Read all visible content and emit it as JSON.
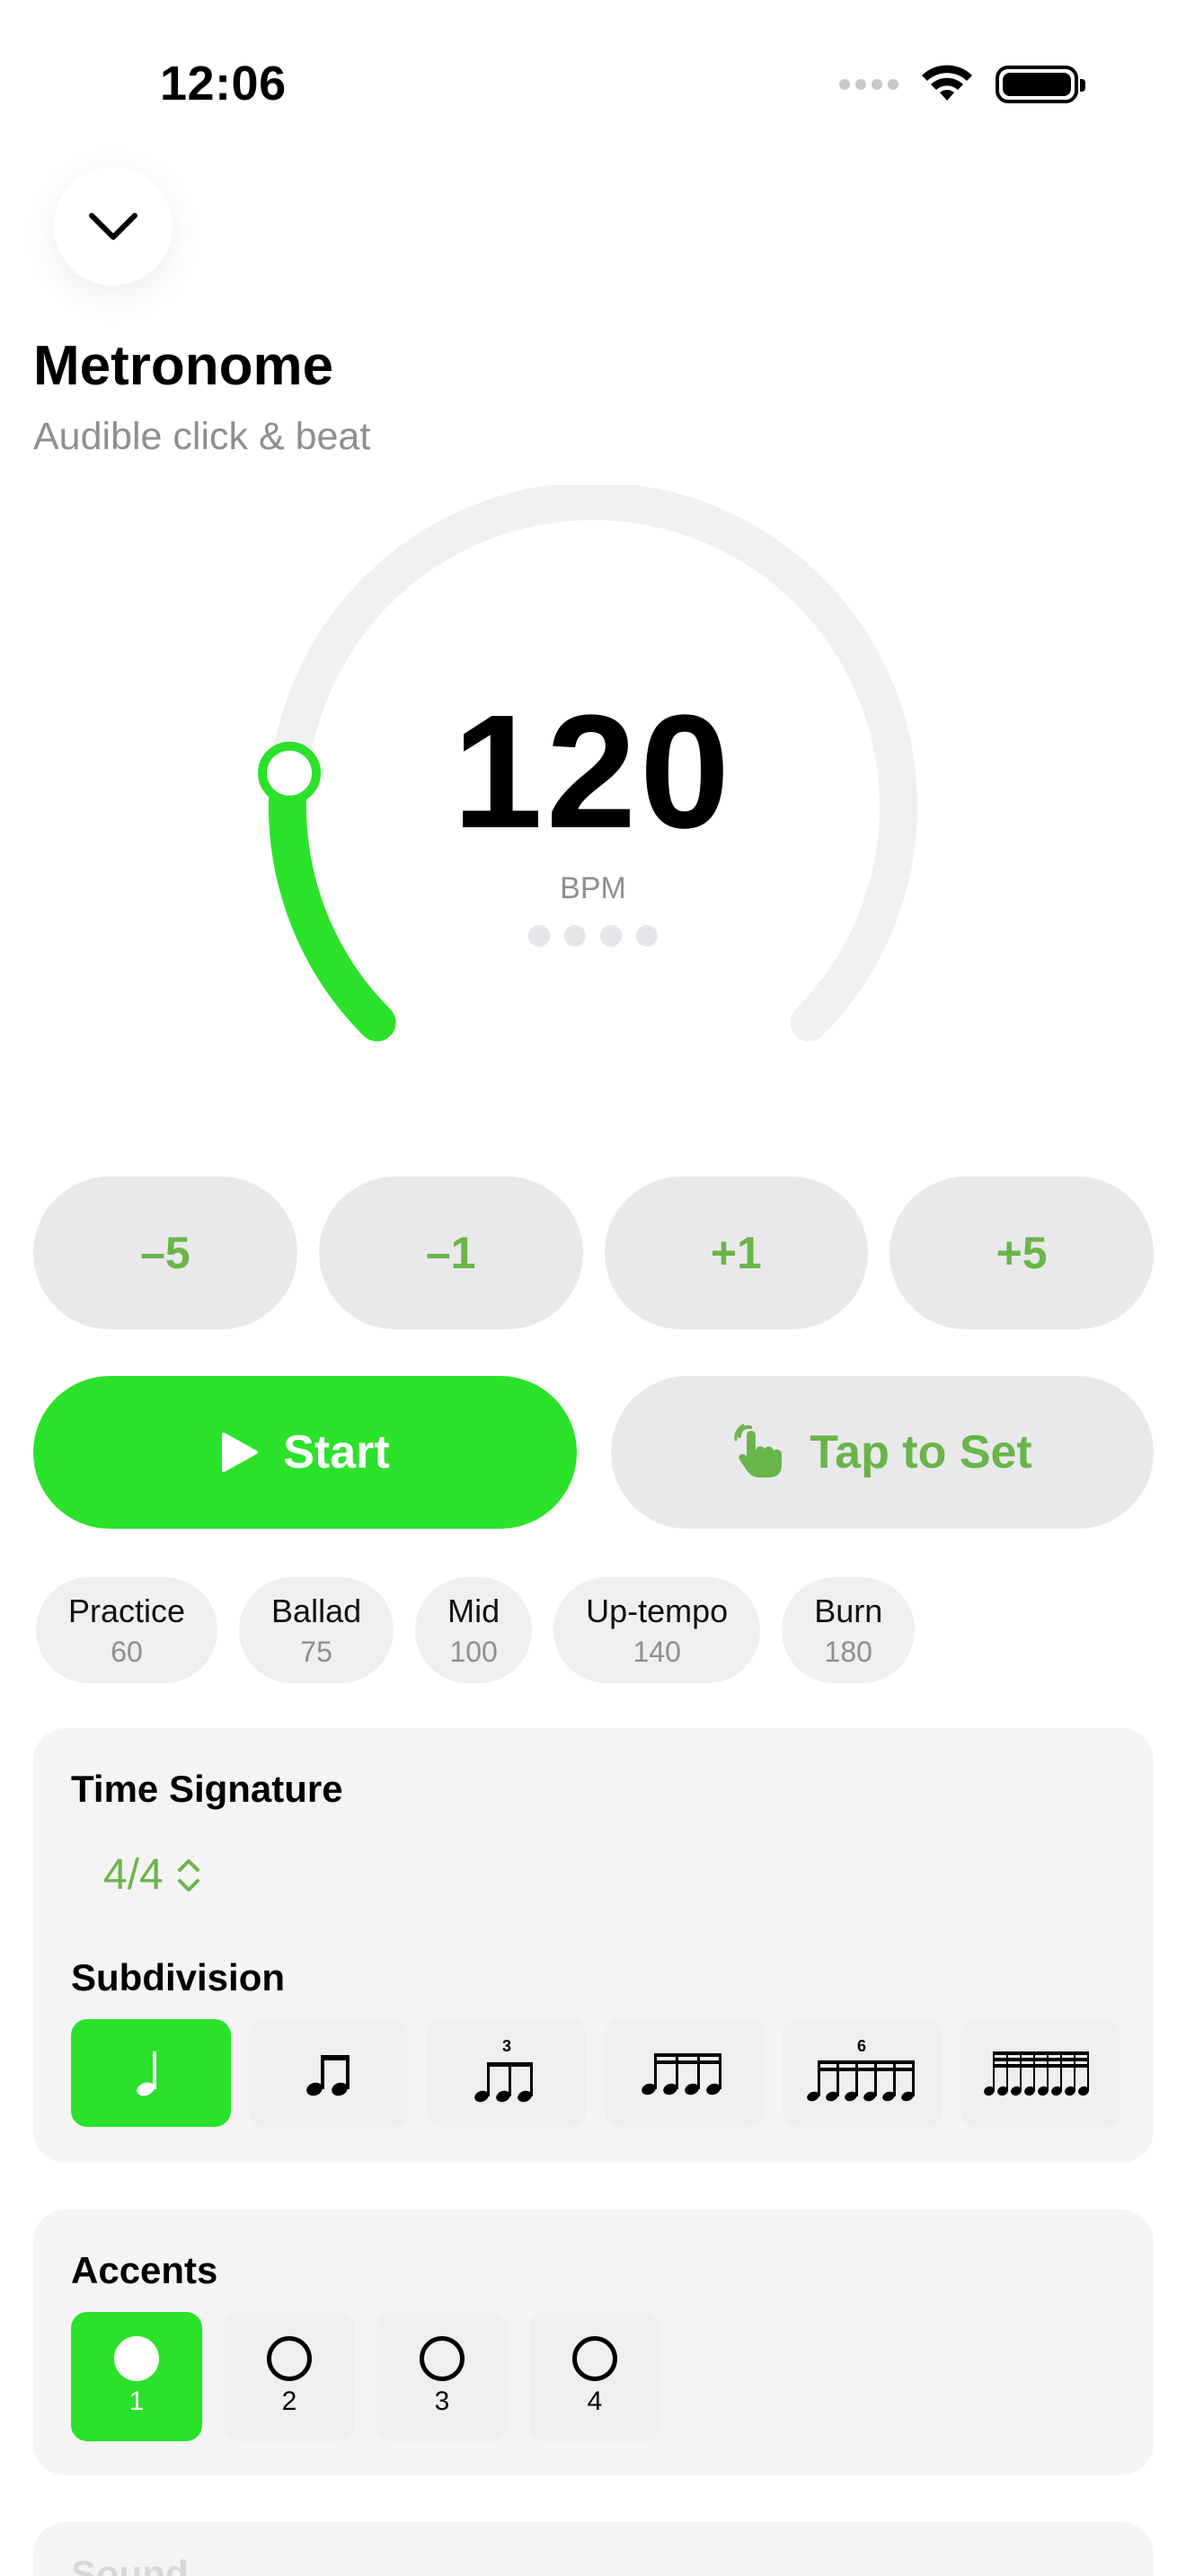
{
  "status": {
    "time": "12:06"
  },
  "header": {
    "title": "Metronome",
    "subtitle": "Audible click & beat"
  },
  "tempo": {
    "bpm": "120",
    "unit": "BPM",
    "dial_fraction": 0.19
  },
  "steps": [
    {
      "label": "–5"
    },
    {
      "label": "–1"
    },
    {
      "label": "+1"
    },
    {
      "label": "+5"
    }
  ],
  "actions": {
    "start_label": "Start",
    "tap_label": "Tap to Set"
  },
  "presets": [
    {
      "name": "Practice",
      "value": "60"
    },
    {
      "name": "Ballad",
      "value": "75"
    },
    {
      "name": "Mid",
      "value": "100"
    },
    {
      "name": "Up-tempo",
      "value": "140"
    },
    {
      "name": "Burn",
      "value": "180"
    }
  ],
  "time_signature": {
    "heading": "Time Signature",
    "value": "4/4"
  },
  "subdivision": {
    "heading": "Subdivision",
    "triplet_mark": "3",
    "sextuplet_mark": "6"
  },
  "accents": {
    "heading": "Accents",
    "beats": [
      {
        "num": "1"
      },
      {
        "num": "2"
      },
      {
        "num": "3"
      },
      {
        "num": "4"
      }
    ]
  },
  "sound": {
    "heading": "Sound"
  },
  "colors": {
    "accent": "#2ae22a",
    "accent_text": "#6ab54a",
    "track": "#f0f0f3"
  }
}
